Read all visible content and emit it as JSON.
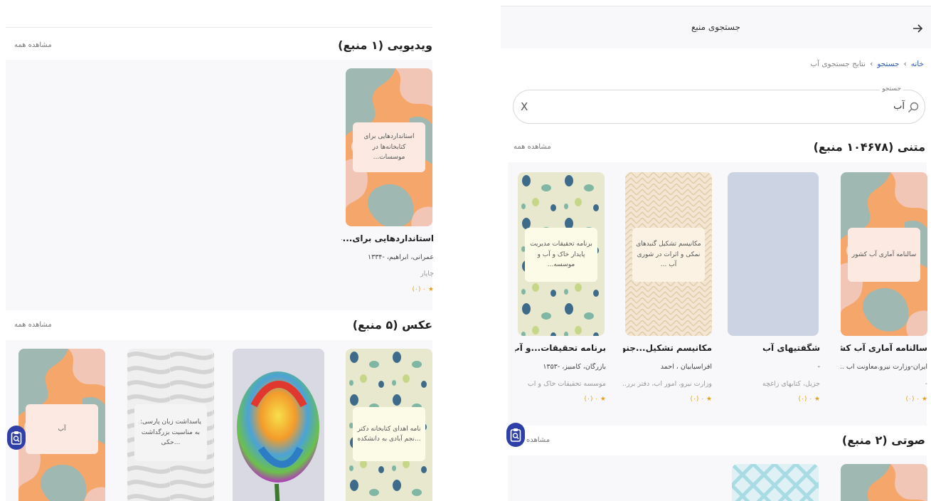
{
  "colors": {
    "accent": "#2f3fa8",
    "link": "#2a5db0",
    "star": "#e6a11c",
    "panel": "#f8f8fb"
  },
  "left": {
    "video": {
      "title": "ویدیویی (۱ منبع)",
      "see_all": "مشاهده همه",
      "card": {
        "cover_text": "استانداردهایی برای کتابخانه‌ها در موسسات...",
        "title": "استانداردهایی برای...عال...",
        "author": "عمرانی، ابراهیم، -۱۳۳۴",
        "publisher": "چاپار",
        "rating": "★ ۰ (۰)"
      }
    },
    "photo": {
      "title": "عکس (۵ منبع)",
      "see_all": "مشاهده همه",
      "cards": [
        {
          "cover_text": "نامه اهدای کتابخانه دکتر نجم آبادی به دانشکده..."
        },
        {
          "cover_text": ""
        },
        {
          "cover_text": "یاسداشت زبان پارسی: به مناسبت بزرگداشت حکی..."
        },
        {
          "cover_text": "آب"
        }
      ]
    },
    "fab_icon": "clipboard-search-icon"
  },
  "right": {
    "header": {
      "title": "جستجوی منبع",
      "back_icon": "arrow-right-icon"
    },
    "breadcrumb": {
      "home": "خانه",
      "search": "جستجو",
      "current": "نتایج جستجوی آب",
      "separator": "›"
    },
    "search": {
      "label": "جستجو",
      "value": "آب",
      "clear": "X",
      "icon": "search-icon"
    },
    "text": {
      "title": "متنی (۱۰۴۶۷۸ منبع)",
      "see_all": "مشاهده همه",
      "cards": [
        {
          "cover_text": "سالنامه آماری آب کشور",
          "title": "سالنامه آماری آب کشور",
          "author": "ایران-وزارت نیرو.معاونت آب ...",
          "publisher": "-",
          "rating": "★ ۰ (۰)"
        },
        {
          "cover_text": "",
          "title": "شگفتیهای آب",
          "author": "-",
          "publisher": "جزیل، کتابهای زاغچه",
          "rating": "★ ۰ (۰)"
        },
        {
          "cover_text": "مکانیسم تشکیل گنبدهای نمکی و اثرات در شوری آب ...",
          "title": "مکانیسم تشکیل...جنو...",
          "author": "افراسیابیان ، احمد",
          "publisher": "وزارت نیرو، امور آب، دفتر برر...",
          "rating": "★ ۰ (۰)"
        },
        {
          "cover_text": "برنامه تحقیقات مدیریت پایدار خاک و آب و موسسه...",
          "title": "برنامه تحقیقات...و آب",
          "author": "بازرگان، کامبیز، -۱۳۵۳",
          "publisher": "موسسه تحقیقات خاک و آب",
          "rating": "★ ۰ (۰)"
        }
      ]
    },
    "audio": {
      "title": "صوتی (۲ منبع)",
      "see_all": "مشاهده"
    },
    "fab_icon": "clipboard-search-icon"
  }
}
